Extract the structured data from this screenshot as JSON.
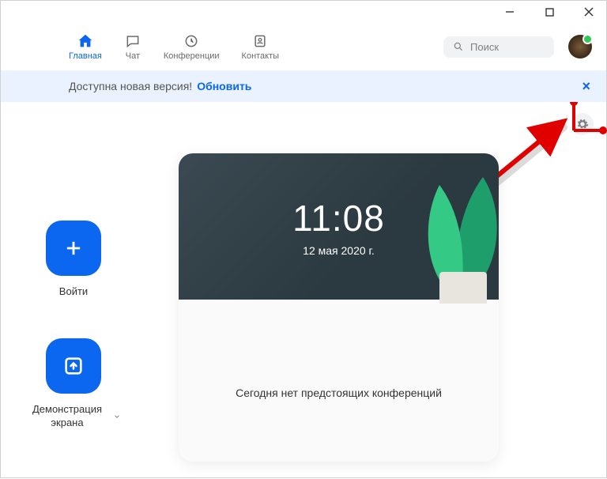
{
  "window": {
    "search_placeholder": "Поиск"
  },
  "tabs": {
    "home": "Главная",
    "chat": "Чат",
    "meetings": "Конференции",
    "contacts": "Контакты"
  },
  "banner": {
    "text": "Доступна новая версия!",
    "link": "Обновить"
  },
  "actions": {
    "join": "Войти",
    "share": "Демонстрация экрана"
  },
  "card": {
    "time": "11:08",
    "date": "12 мая 2020 г.",
    "empty_msg": "Сегодня нет предстоящих конференций"
  }
}
